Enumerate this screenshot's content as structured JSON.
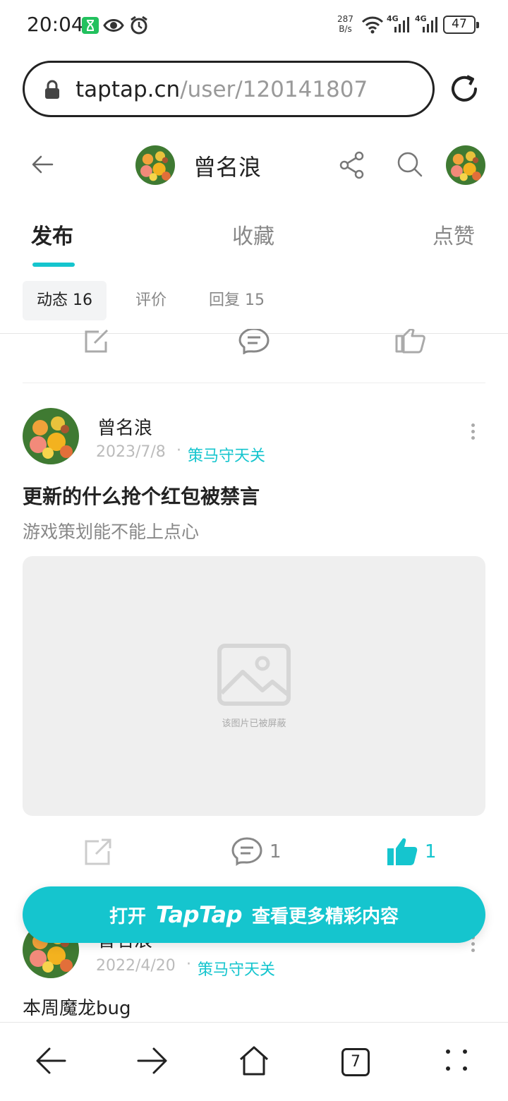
{
  "status_bar": {
    "time": "20:04",
    "net_speed_value": "287",
    "net_speed_unit": "B/s",
    "signal1_label": "4G",
    "signal2_label": "4G",
    "battery": "47"
  },
  "browser": {
    "url_host": "taptap.cn",
    "url_path": "/user/120141807"
  },
  "header": {
    "user_name": "曾名浪"
  },
  "tabs": [
    {
      "label": "发布"
    },
    {
      "label": "收藏"
    },
    {
      "label": "点赞"
    }
  ],
  "chips": [
    {
      "label": "动态 16"
    },
    {
      "label": "评价"
    },
    {
      "label": "回复 15"
    }
  ],
  "post": {
    "author": "曾名浪",
    "date": "2023/7/8",
    "dot": "·",
    "game": "策马守天关",
    "title": "更新的什么抢个红包被禁言",
    "body": "游戏策划能不能上点心",
    "image_caption": "该图片已被屏蔽",
    "comment_count": "1",
    "like_count": "1"
  },
  "post2": {
    "author": "曾名浪",
    "date": "2022/4/20",
    "dot": "·",
    "game": "策马守天关",
    "text": "本周魔龙bug"
  },
  "banner": {
    "prefix": "打开",
    "brand": "TapTap",
    "suffix": "查看更多精彩内容"
  },
  "bottom_nav": {
    "tab_count": "7"
  },
  "colors": {
    "accent": "#15c5ce",
    "text": "#222222",
    "muted": "#888888",
    "image_placeholder": "#efefef"
  }
}
